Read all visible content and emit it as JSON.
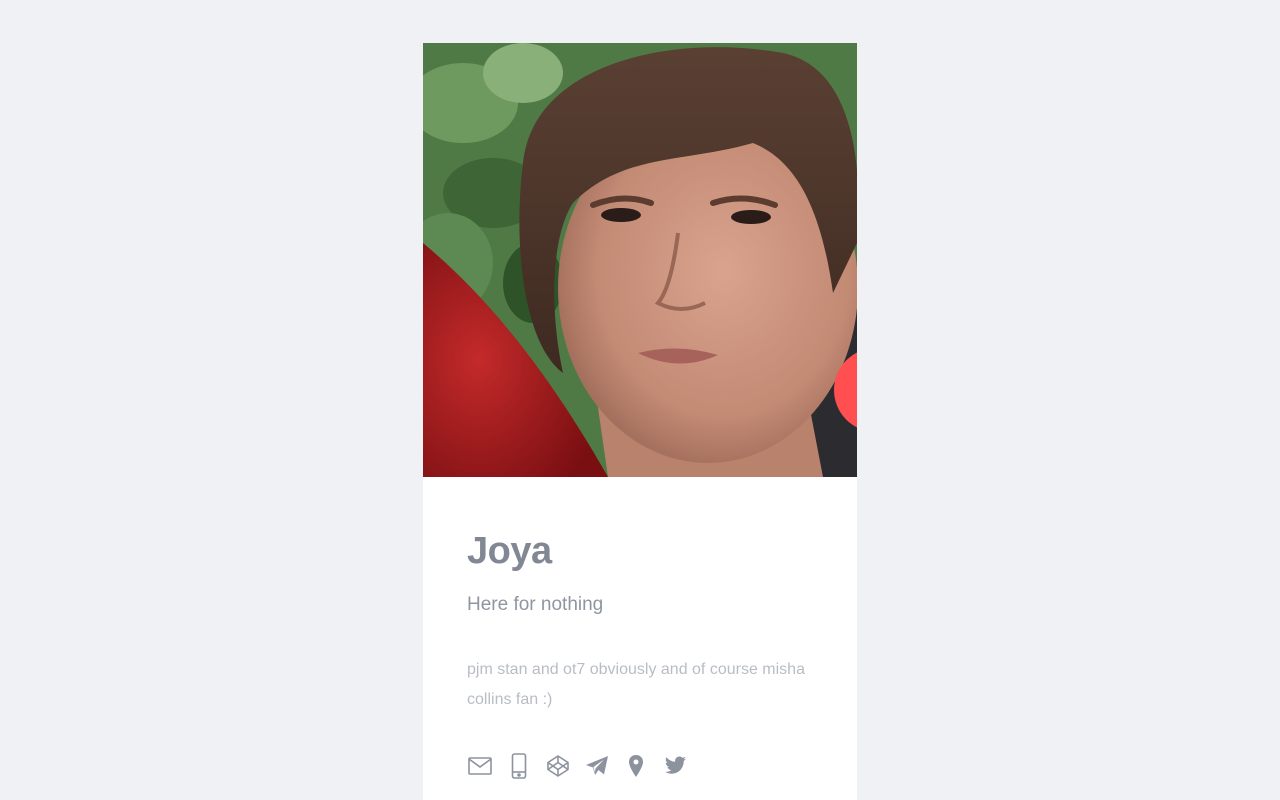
{
  "profile": {
    "name": "Joya",
    "tagline": "Here for nothing",
    "bio": "pjm stan and ot7 obviously and of course misha collins fan :)",
    "photo_description": "profile-photo",
    "accent_color": "#ff4f50"
  },
  "contact_icons": [
    {
      "name": "mail-icon"
    },
    {
      "name": "phone-icon"
    },
    {
      "name": "codepen-icon"
    },
    {
      "name": "telegram-icon"
    },
    {
      "name": "location-pin-icon"
    },
    {
      "name": "twitter-icon"
    }
  ]
}
